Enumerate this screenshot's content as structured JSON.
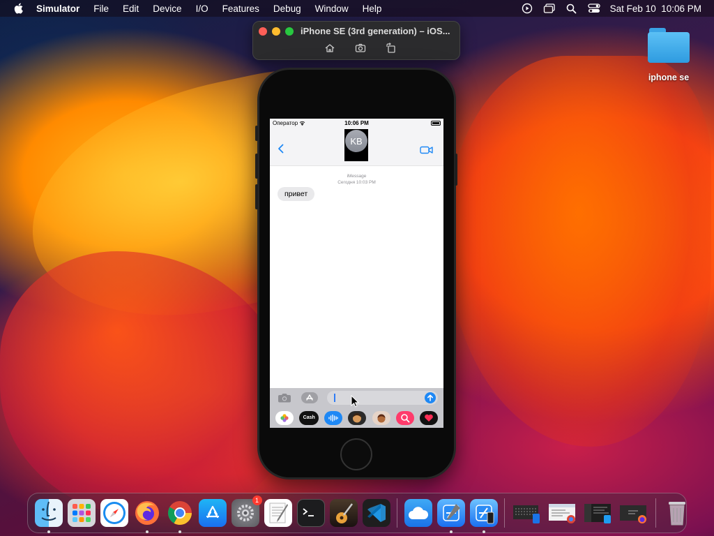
{
  "menubar": {
    "app_name": "Simulator",
    "items": [
      "File",
      "Edit",
      "Device",
      "I/O",
      "Features",
      "Debug",
      "Window",
      "Help"
    ],
    "clock": "Sat Feb 10  10:06 PM"
  },
  "desktop": {
    "folder_label": "iphone se"
  },
  "simulator": {
    "title": "iPhone SE (3rd generation) – iOS...",
    "tools": [
      "home-icon",
      "screenshot-icon",
      "rotate-icon"
    ]
  },
  "ios": {
    "carrier": "Оператор",
    "time": "10:06 PM",
    "avatar_initials": "KB",
    "service": "iMessage",
    "timestamp": "Сегодня 10:03 PM",
    "message": "привет",
    "app_strip": [
      "photos",
      "Cash",
      "audio",
      "memoji-1",
      "memoji-2",
      "search-images",
      "digital-touch"
    ],
    "cash_label": "Cash"
  },
  "dock": {
    "apps": [
      "Finder",
      "Launchpad",
      "Safari",
      "Firefox",
      "Chrome",
      "App Store",
      "System Settings",
      "TextEdit",
      "Terminal",
      "GarageBand",
      "VS Code",
      "iCloud",
      "Xcode",
      "Simulator"
    ],
    "settings_badge": "1"
  },
  "colors": {
    "accent": "#1e88f5",
    "bubble": "#e9e9eb"
  }
}
